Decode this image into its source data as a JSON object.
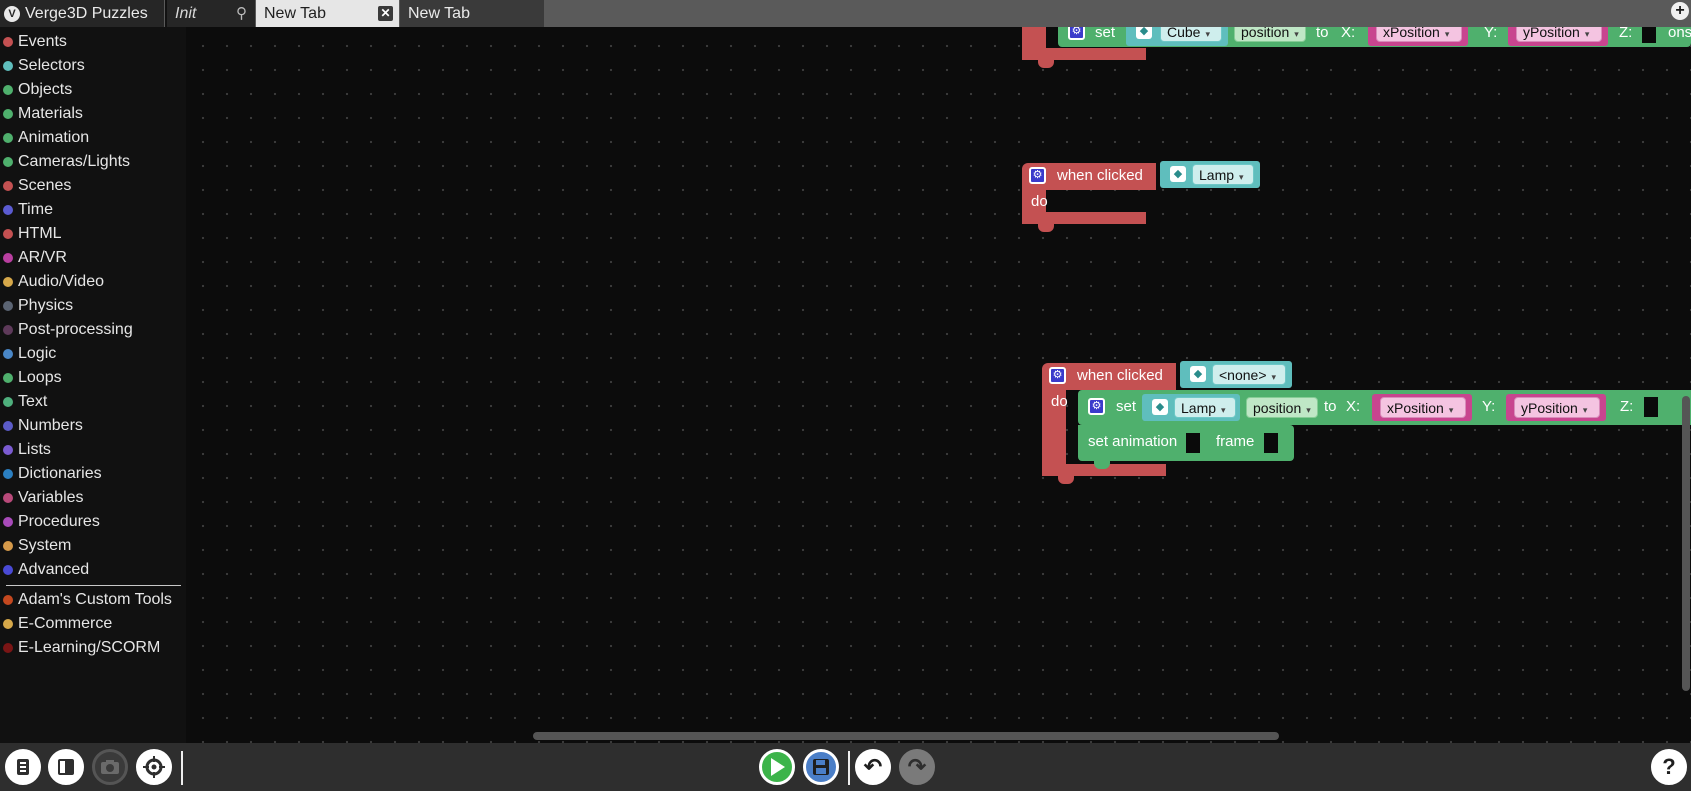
{
  "tabbar": {
    "app_name": "Verge3D Puzzles",
    "tabs": [
      {
        "label": "Init",
        "pinned": true
      },
      {
        "label": "New Tab",
        "active": true
      },
      {
        "label": "New Tab"
      }
    ],
    "close_glyph": "✕",
    "pin_glyph": "⚲",
    "add_glyph": "+"
  },
  "sidebar": {
    "categories": [
      {
        "label": "Events",
        "color": "#c45152"
      },
      {
        "label": "Selectors",
        "color": "#5fbebd"
      },
      {
        "label": "Objects",
        "color": "#4fb06d"
      },
      {
        "label": "Materials",
        "color": "#4fb06d"
      },
      {
        "label": "Animation",
        "color": "#4fb06d"
      },
      {
        "label": "Cameras/Lights",
        "color": "#4fb06d"
      },
      {
        "label": "Scenes",
        "color": "#c45152"
      },
      {
        "label": "Time",
        "color": "#5b5bd1"
      },
      {
        "label": "HTML",
        "color": "#c45152"
      },
      {
        "label": "AR/VR",
        "color": "#b93fa0"
      },
      {
        "label": "Audio/Video",
        "color": "#d6a84a"
      },
      {
        "label": "Physics",
        "color": "#5b6473"
      },
      {
        "label": "Post-processing",
        "color": "#5e3a5a"
      },
      {
        "label": "Logic",
        "color": "#4a87c7"
      },
      {
        "label": "Loops",
        "color": "#4fb06d"
      },
      {
        "label": "Text",
        "color": "#4fb07d"
      },
      {
        "label": "Numbers",
        "color": "#5b5bc7"
      },
      {
        "label": "Lists",
        "color": "#7b5bd1"
      },
      {
        "label": "Dictionaries",
        "color": "#2b7fc1"
      },
      {
        "label": "Variables",
        "color": "#b94a7a"
      },
      {
        "label": "Procedures",
        "color": "#a84ab9"
      },
      {
        "label": "System",
        "color": "#d69a4a"
      },
      {
        "label": "Advanced",
        "color": "#4a4ad6"
      }
    ],
    "custom": [
      {
        "label": "Adam's Custom Tools",
        "color": "#c4481f"
      },
      {
        "label": "E-Commerce",
        "color": "#d6a84a"
      },
      {
        "label": "E-Learning/SCORM",
        "color": "#7a1515"
      }
    ]
  },
  "workspace": {
    "block1": {
      "set": "set",
      "object": "Cube",
      "property": "position",
      "to": "to",
      "x_label": "X:",
      "x_var": "xPosition",
      "y_label": "Y:",
      "y_var": "yPosition",
      "z_label": "Z:",
      "trailing": "ons"
    },
    "block2": {
      "event": "when clicked",
      "object": "Lamp",
      "do": "do"
    },
    "block3": {
      "event": "when clicked",
      "object": "<none>",
      "do": "do",
      "set": "set",
      "set_object": "Lamp",
      "property": "position",
      "to": "to",
      "x_label": "X:",
      "x_var": "xPosition",
      "y_label": "Y:",
      "y_var": "yPosition",
      "z_label": "Z:",
      "anim_label": "set animation",
      "frame_label": "frame"
    },
    "gear_glyph": "⚙",
    "cube_glyph": "◆",
    "arrow_glyph": "▾"
  },
  "toolbar": {
    "icons": {
      "library": "library-icon",
      "snippet": "sidebar-icon",
      "screenshot": "camera-icon",
      "center": "crosshair-icon",
      "run": "play-icon",
      "save": "save-icon",
      "undo": "undo-icon",
      "redo": "redo-icon",
      "help": "help-icon"
    },
    "help_glyph": "?",
    "undo_glyph": "↶",
    "redo_glyph": "↷"
  },
  "colors": {
    "events": "#c45152",
    "selectors": "#5fbebd",
    "objects": "#4fb06d",
    "variables": "#c8458f",
    "run": "#3cb44a",
    "save": "#4a7ec7"
  }
}
